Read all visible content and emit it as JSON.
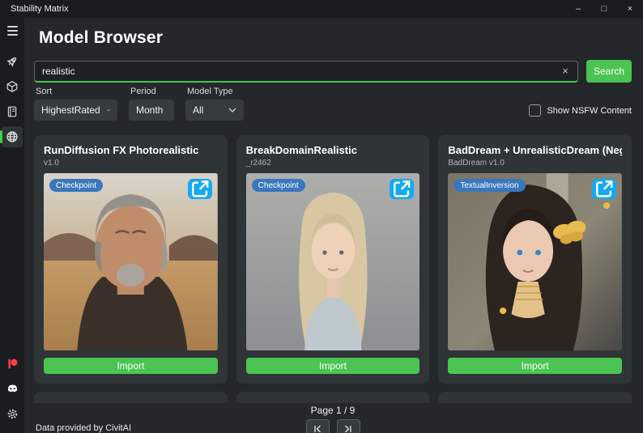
{
  "window": {
    "title": "Stability Matrix",
    "minimize": "–",
    "maximize": "□",
    "close": "×"
  },
  "header": {
    "title": "Model Browser"
  },
  "search": {
    "value": "realistic",
    "clear": "×",
    "button": "Search"
  },
  "filters": {
    "sort": {
      "label": "Sort",
      "value": "HighestRated"
    },
    "period": {
      "label": "Period",
      "value": "Month"
    },
    "model_type": {
      "label": "Model Type",
      "value": "All"
    },
    "nsfw": {
      "label": "Show NSFW Content",
      "checked": false
    }
  },
  "sidebar": {
    "items": [
      {
        "icon": "hamburger-menu-icon"
      },
      {
        "icon": "rocket-launch-icon"
      },
      {
        "icon": "package-cube-icon"
      },
      {
        "icon": "checkpoints-notebook-icon"
      },
      {
        "icon": "model-browser-globe-icon",
        "selected": true
      },
      {
        "icon": "patreon-icon"
      },
      {
        "icon": "discord-icon"
      },
      {
        "icon": "settings-gear-icon"
      }
    ]
  },
  "cards": [
    {
      "title": "RunDiffusion FX Photorealistic",
      "version": "v1.0",
      "badge": "Checkpoint",
      "import": "Import"
    },
    {
      "title": "BreakDomainRealistic",
      "version": "_r2462",
      "badge": "Checkpoint",
      "import": "Import"
    },
    {
      "title": "BadDream + UnrealisticDream (Negative Embedding)",
      "version": "BadDream v1.0",
      "badge": "TextualInversion",
      "import": "Import"
    }
  ],
  "pagination": {
    "label": "Page 1 / 9"
  },
  "footer": {
    "status": "Data provided by CivitAI"
  },
  "colors": {
    "accent": "#4cc453",
    "badge": "#3a77bd",
    "open_button": "#14a9f3",
    "patreon": "#ff424d",
    "selected_indicator": "#42cf42"
  }
}
